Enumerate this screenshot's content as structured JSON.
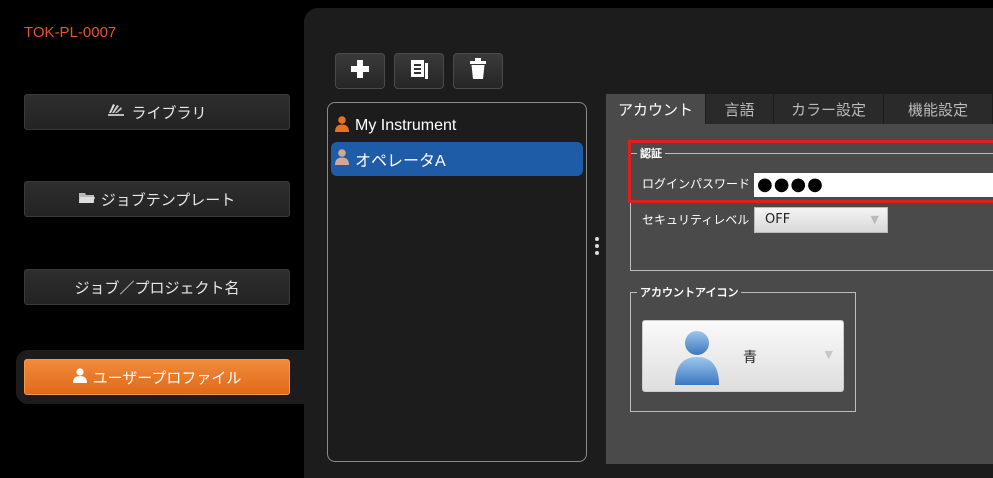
{
  "app": {
    "id": "TOK-PL-0007"
  },
  "nav": {
    "library": "ライブラリ",
    "job_template": "ジョブテンプレート",
    "job_project": "ジョブ／プロジェクト名",
    "user_profile": "ユーザープロファイル"
  },
  "toolbar": {
    "icons": [
      "plus-icon",
      "copy-icon",
      "trash-icon"
    ]
  },
  "profiles": [
    {
      "name": "My Instrument",
      "selected": false
    },
    {
      "name": "オペレータA",
      "selected": true
    }
  ],
  "tabs": [
    {
      "label": "アカウント",
      "active": true
    },
    {
      "label": "言語",
      "active": false
    },
    {
      "label": "カラー設定",
      "active": false
    },
    {
      "label": "機能設定",
      "active": false
    }
  ],
  "auth": {
    "group_title": "認証",
    "password_label": "ログインパスワード",
    "password_value": "●●●●",
    "security_label": "セキュリティレベル",
    "security_value": "OFF"
  },
  "account_icon": {
    "group_title": "アカウントアイコン",
    "value": "青"
  },
  "colors": {
    "accent": "#e8542a",
    "selected": "#1f5ca8",
    "highlight": "#e02020"
  }
}
